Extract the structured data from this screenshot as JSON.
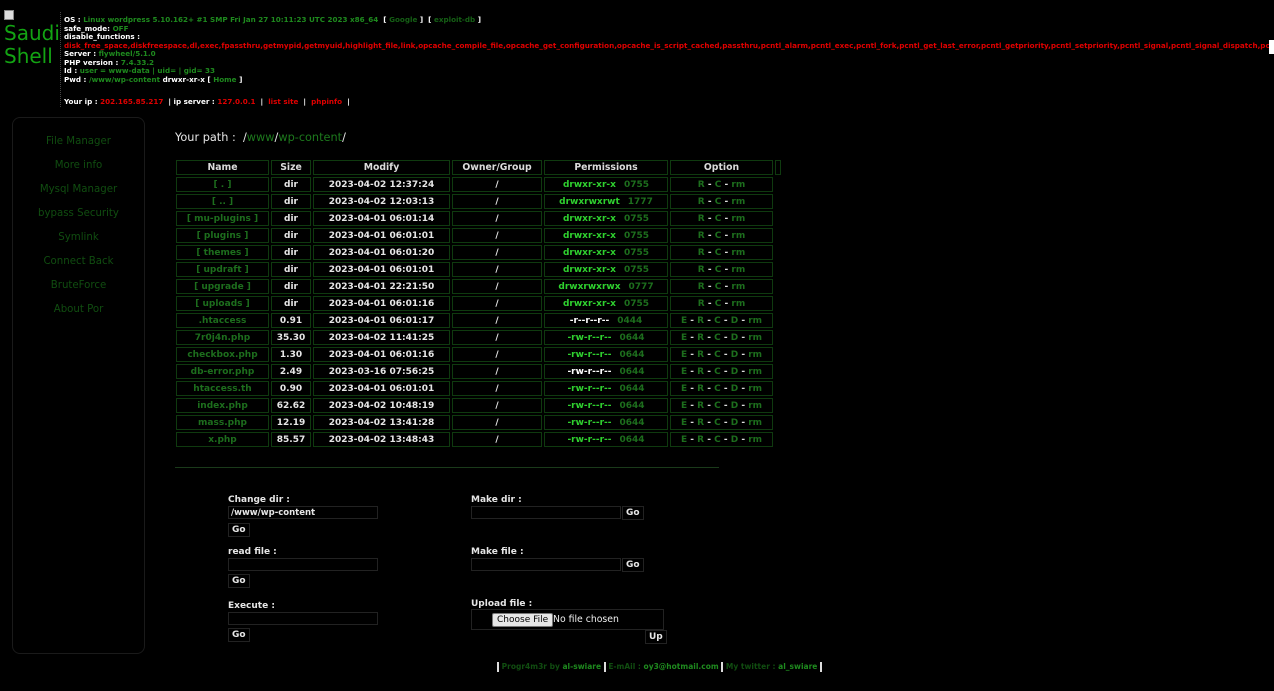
{
  "logo": {
    "line1": "Saudi",
    "line2": "Shell"
  },
  "info": {
    "os_label": "OS :",
    "os_value": "Linux wordpress 5.10.162+ #1 SMP Fri Jan 27 10:11:23 UTC 2023 x86_64",
    "google": "Google",
    "exploit_db": "exploit-db",
    "safe_mode_label": "safe_mode:",
    "safe_mode_value": "OFF",
    "disable_functions_label": "disable_functions :",
    "disable_functions_value": "disk_free_space,diskfreespace,dl,exec,fpassthru,getmypid,getmyuid,highlight_file,link,opcache_compile_file,opcache_get_configuration,opcache_is_script_cached,passthru,pcntl_alarm,pcntl_exec,pcntl_fork,pcntl_get_last_error,pcntl_getpriority,pcntl_setpriority,pcntl_signal,pcntl_signal_dispatch,pcntl_sigprocmask,pcntl_sigtimedwait,pcntl_sigwaitinfo,pcntl",
    "server_label": "Server :",
    "server_value": "flywheel/5.1.0",
    "php_label": "PHP version :",
    "php_value": "7.4.33.2",
    "id_label": "Id :",
    "id_value": "user = www-data | uid= | gid= 33",
    "pwd_label": "Pwd :",
    "pwd_value": "/www/wp-content",
    "pwd_perm": "drwxr-xr-x",
    "home": "Home"
  },
  "ip_row": {
    "your_ip_label": "Your ip :",
    "your_ip": "202.165.85.217",
    "ip_server_label": "| ip server :",
    "ip_server": "127.0.0.1",
    "list_site": "list site",
    "phpinfo": "phpinfo"
  },
  "sidebar": {
    "items": [
      "File Manager",
      "More info",
      "Mysql Manager",
      "bypass Security",
      "Symlink",
      "Connect Back",
      "BruteForce",
      "About Por"
    ]
  },
  "path": {
    "label": "Your path :",
    "root": "/",
    "seg1": "www",
    "seg2": "wp-content",
    "sep": "/"
  },
  "table": {
    "headers": [
      "Name",
      "Size",
      "Modify",
      "Owner/Group",
      "Permissions",
      "Option"
    ],
    "dir_option": [
      "R",
      "C",
      "rm"
    ],
    "file_option": [
      "E",
      "R",
      "C",
      "D",
      "rm"
    ],
    "rows": [
      {
        "name": "[ . ]",
        "size": "dir",
        "modify": "2023-04-02 12:37:24",
        "owner": "/",
        "perm": "drwxr-xr-x",
        "octal": "0755",
        "type": "dir"
      },
      {
        "name": "[ .. ]",
        "size": "dir",
        "modify": "2023-04-02 12:03:13",
        "owner": "/",
        "perm": "drwxrwxrwt",
        "octal": "1777",
        "type": "dir"
      },
      {
        "name": "[ mu-plugins ]",
        "size": "dir",
        "modify": "2023-04-01 06:01:14",
        "owner": "/",
        "perm": "drwxr-xr-x",
        "octal": "0755",
        "type": "dir"
      },
      {
        "name": "[ plugins ]",
        "size": "dir",
        "modify": "2023-04-01 06:01:01",
        "owner": "/",
        "perm": "drwxr-xr-x",
        "octal": "0755",
        "type": "dir"
      },
      {
        "name": "[ themes ]",
        "size": "dir",
        "modify": "2023-04-01 06:01:20",
        "owner": "/",
        "perm": "drwxr-xr-x",
        "octal": "0755",
        "type": "dir"
      },
      {
        "name": "[ updraft ]",
        "size": "dir",
        "modify": "2023-04-01 06:01:01",
        "owner": "/",
        "perm": "drwxr-xr-x",
        "octal": "0755",
        "type": "dir"
      },
      {
        "name": "[ upgrade ]",
        "size": "dir",
        "modify": "2023-04-01 22:21:50",
        "owner": "/",
        "perm": "drwxrwxrwx",
        "octal": "0777",
        "type": "dir"
      },
      {
        "name": "[ uploads ]",
        "size": "dir",
        "modify": "2023-04-01 06:01:16",
        "owner": "/",
        "perm": "drwxr-xr-x",
        "octal": "0755",
        "type": "dir"
      },
      {
        "name": ".htaccess",
        "size": "0.91",
        "modify": "2023-04-01 06:01:17",
        "owner": "/",
        "perm": "-r--r--r--",
        "octal": "0444",
        "type": "file",
        "white": true
      },
      {
        "name": "7r0j4n.php",
        "size": "35.30",
        "modify": "2023-04-02 11:41:25",
        "owner": "/",
        "perm": "-rw-r--r--",
        "octal": "0644",
        "type": "file"
      },
      {
        "name": "checkbox.php",
        "size": "1.30",
        "modify": "2023-04-01 06:01:16",
        "owner": "/",
        "perm": "-rw-r--r--",
        "octal": "0644",
        "type": "file"
      },
      {
        "name": "db-error.php",
        "size": "2.49",
        "modify": "2023-03-16 07:56:25",
        "owner": "/",
        "perm": "-rw-r--r--",
        "octal": "0644",
        "type": "file",
        "white": true
      },
      {
        "name": "htaccess.th",
        "size": "0.90",
        "modify": "2023-04-01 06:01:01",
        "owner": "/",
        "perm": "-rw-r--r--",
        "octal": "0644",
        "type": "file"
      },
      {
        "name": "index.php",
        "size": "62.62",
        "modify": "2023-04-02 10:48:19",
        "owner": "/",
        "perm": "-rw-r--r--",
        "octal": "0644",
        "type": "file"
      },
      {
        "name": "mass.php",
        "size": "12.19",
        "modify": "2023-04-02 13:41:28",
        "owner": "/",
        "perm": "-rw-r--r--",
        "octal": "0644",
        "type": "file"
      },
      {
        "name": "x.php",
        "size": "85.57",
        "modify": "2023-04-02 13:48:43",
        "owner": "/",
        "perm": "-rw-r--r--",
        "octal": "0644",
        "type": "file"
      }
    ]
  },
  "forms": {
    "change_dir_label": "Change dir :",
    "change_dir_value": "/www/wp-content",
    "make_dir_label": "Make dir :",
    "read_file_label": "read file :",
    "make_file_label": "Make file :",
    "execute_label": "Execute :",
    "upload_label": "Upload file :",
    "go": "Go",
    "choose_file": "Choose File",
    "no_file": "No file chosen",
    "up": "Up"
  },
  "footer": {
    "prog_label": "Progr4m3r by",
    "prog_value": "al-swiare",
    "email_label": "E-mAil :",
    "email_value": "oy3@hotmail.com",
    "twitter_label": "My twitter :",
    "twitter_value": "al_swiare"
  }
}
